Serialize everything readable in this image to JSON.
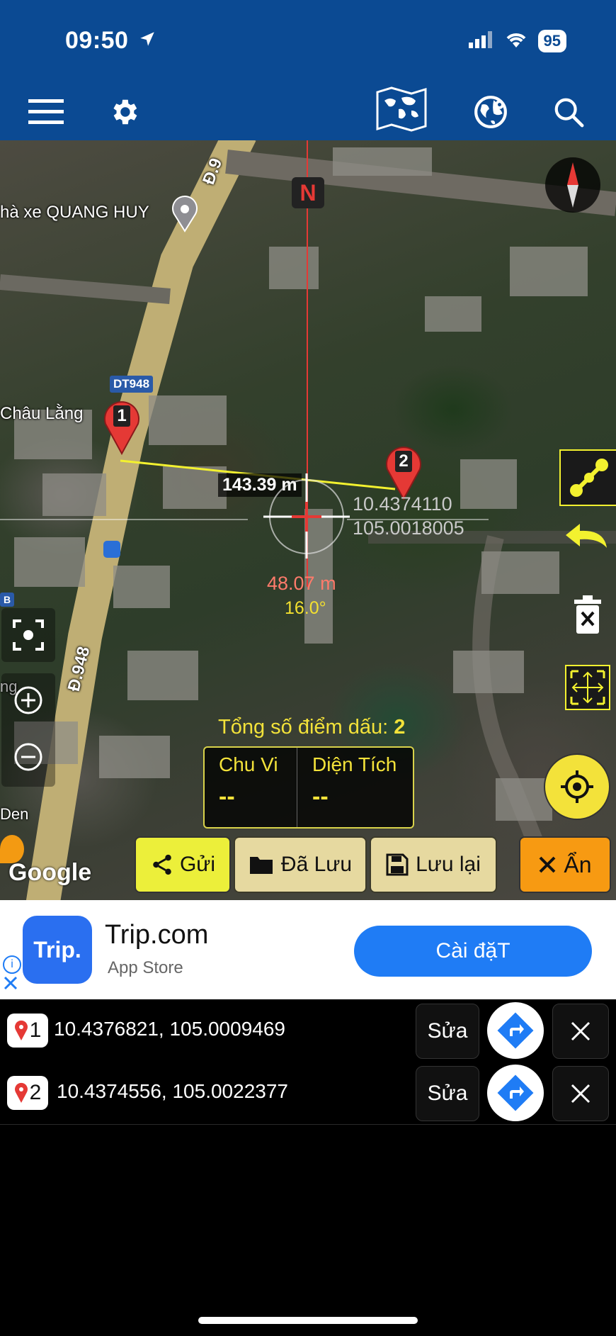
{
  "status": {
    "time": "09:50",
    "battery": "95"
  },
  "toolbar": {
    "menu": "menu-icon",
    "settings": "gear-icon",
    "map_type": "world-map-icon",
    "globe": "globe-icon",
    "search": "search-icon"
  },
  "map": {
    "compass_label": "N",
    "road_label_top": "Đ.9",
    "road_label_bottom": "Đ.948",
    "road_badge": "DT948",
    "poi_label": "hà xe QUANG HUY",
    "place_label": "Châu Lằng",
    "place_label_2": "ng",
    "place_label_3": "Den",
    "place_badge": "B",
    "marker_1": "1",
    "marker_2": "2",
    "distance_label": "143.39 m",
    "crosshair_lat": "10.4374110",
    "crosshair_lng": "105.0018005",
    "crosshair_dist": "48.07 m",
    "crosshair_bearing": "16.0°",
    "total_label": "Tổng số điểm dấu:",
    "total_count": "2",
    "perimeter_label": "Chu Vi",
    "perimeter_value": "--",
    "area_label": "Diện Tích",
    "area_value": "--",
    "google_logo": "Google"
  },
  "actions": {
    "send": "Gửi",
    "saved": "Đã Lưu",
    "save": "Lưu lại",
    "hide": "Ẩn"
  },
  "ad": {
    "icon_text": "Trip.",
    "title": "Trip.com",
    "subtitle": "App Store",
    "install": "Cài đặT"
  },
  "points": [
    {
      "index": "1",
      "coords": "10.4376821, 105.0009469",
      "edit": "Sửa"
    },
    {
      "index": "2",
      "coords": "10.4374556, 105.0022377",
      "edit": "Sửa"
    }
  ],
  "colors": {
    "brand": "#0b4a93",
    "accent_yellow": "#f3f12f",
    "hide_orange": "#f79a12",
    "ad_blue": "#1f7cf5",
    "marker_red": "#e53935"
  }
}
